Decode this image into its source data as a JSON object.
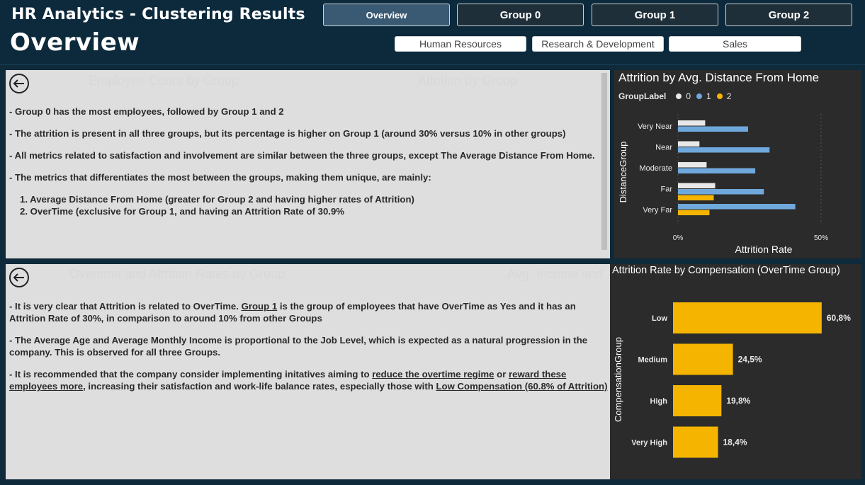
{
  "header": {
    "app_title": "HR Analytics - Clustering Results",
    "page_title": "Overview",
    "nav": [
      "Overview",
      "Group 0",
      "Group 1",
      "Group 2"
    ],
    "departments": [
      "Human Resources",
      "Research & Development",
      "Sales"
    ]
  },
  "top_panel": {
    "ghost_titles": [
      "Employee Count by Group",
      "Attrition by Group"
    ],
    "notes": [
      "- Group 0 has the most employees, followed by Group 1 and 2",
      "- The attrition is present in all three groups, but its percentage is higher on Group 1 (around 30% versus 10% in other groups)",
      "- All metrics related to satisfaction and involvement are similar between the three groups, except The Average Distance From Home.",
      "- The metrics that differentiates the most between the groups, making them unique, are mainly:",
      "1. Average Distance From Home (greater for Group 2 and having higher rates of Attrition)",
      "2. OverTime (exclusive for Group 1, and having an Attrition Rate of 30.9%"
    ]
  },
  "bottom_panel": {
    "ghost_titles": [
      "Overtime and Attrition Rates by Group",
      "Avg. Income and"
    ],
    "notes": {
      "p1_a": "- It is very clear that Attrition is related to OverTime. ",
      "p1_link": "Group 1",
      "p1_b": " is the group of employees that have OverTime as Yes and it has an Attrition Rate of 30%, in comparison to around 10% from other Groups",
      "p2": "- The Average Age and Average Monthly Income is proportional to the Job Level, which is expected as a natural progression in the company. This is observed for all three Groups.",
      "p3_a": "- It is recommended that the company consider implementing initatives aiming to ",
      "p3_link1": "reduce the overtime regime",
      "p3_b": " or ",
      "p3_link2": "reward these employees more",
      "p3_c": ", increasing their satisfaction and work-life balance rates, especially those with ",
      "p3_link3": "Low Compensation (60.8% of Attrition)"
    }
  },
  "chart_data": [
    {
      "type": "bar",
      "title": "Attrition by Avg. Distance From Home",
      "legend_title": "GroupLabel",
      "legend": [
        "0",
        "1",
        "2"
      ],
      "colors": {
        "0": "#e8e8e8",
        "1": "#6fa8dc",
        "2": "#f5b400"
      },
      "orientation": "horizontal",
      "categories": [
        "Very Near",
        "Near",
        "Moderate",
        "Far",
        "Very Far"
      ],
      "series": [
        {
          "name": "0",
          "values": [
            9.5,
            7.5,
            10,
            13,
            null
          ]
        },
        {
          "name": "1",
          "values": [
            24.5,
            32,
            27,
            30,
            41
          ]
        },
        {
          "name": "2",
          "values": [
            null,
            null,
            null,
            12.5,
            11
          ]
        }
      ],
      "xlabel": "Attrition Rate",
      "ylabel": "DistanceGroup",
      "xticks": [
        "0%",
        "50%"
      ],
      "xlim": [
        0,
        50
      ],
      "grid": true
    },
    {
      "type": "bar",
      "title": "Attrition Rate by Compensation (OverTime Group)",
      "orientation": "horizontal",
      "categories": [
        "Low",
        "Medium",
        "High",
        "Very High"
      ],
      "values": [
        60.8,
        24.5,
        19.8,
        18.4
      ],
      "labels": [
        "60,8%",
        "24,5%",
        "19,8%",
        "18,4%"
      ],
      "ylabel": "CompensationGroup",
      "color": "#f5b400",
      "xlim": [
        0,
        62
      ]
    }
  ]
}
